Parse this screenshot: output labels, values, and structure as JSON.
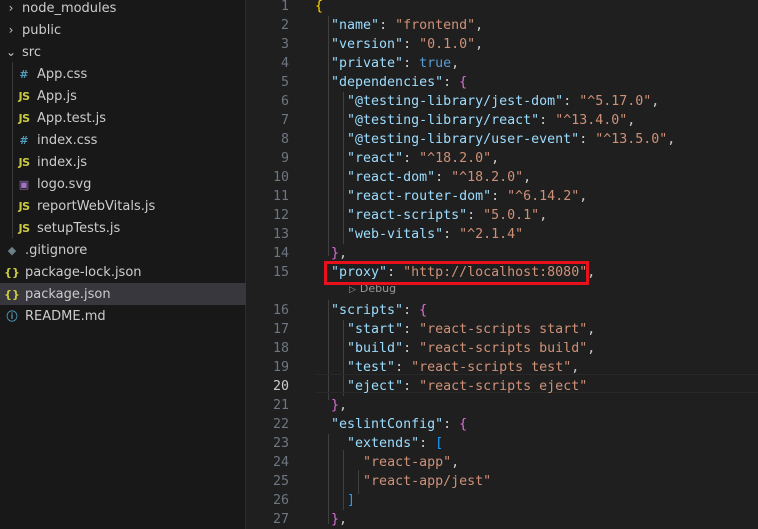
{
  "explorer": {
    "items": [
      {
        "label": "node_modules",
        "type": "folder-collapsed"
      },
      {
        "label": "public",
        "type": "folder-collapsed"
      },
      {
        "label": "src",
        "type": "folder-expanded"
      },
      {
        "label": "App.css",
        "type": "css"
      },
      {
        "label": "App.js",
        "type": "js"
      },
      {
        "label": "App.test.js",
        "type": "js"
      },
      {
        "label": "index.css",
        "type": "css"
      },
      {
        "label": "index.js",
        "type": "js"
      },
      {
        "label": "logo.svg",
        "type": "svg"
      },
      {
        "label": "reportWebVitals.js",
        "type": "js"
      },
      {
        "label": "setupTests.js",
        "type": "js"
      },
      {
        "label": ".gitignore",
        "type": "git"
      },
      {
        "label": "package-lock.json",
        "type": "json"
      },
      {
        "label": "package.json",
        "type": "json",
        "selected": true
      },
      {
        "label": "README.md",
        "type": "info"
      }
    ],
    "icons": {
      "css": "#",
      "js": "JS",
      "svg": "▣",
      "git": "◆",
      "json": "{}",
      "info": "ⓘ",
      "chevron_right": "›",
      "chevron_down": "⌄"
    }
  },
  "editor": {
    "active_line": "20",
    "codelens_label": "Debug",
    "lines": [
      {
        "n": "1",
        "t": "{"
      },
      {
        "n": "2",
        "t": "  \"name\": \"frontend\","
      },
      {
        "n": "3",
        "t": "  \"version\": \"0.1.0\","
      },
      {
        "n": "4",
        "t": "  \"private\": true,"
      },
      {
        "n": "5",
        "t": "  \"dependencies\": {"
      },
      {
        "n": "6",
        "t": "    \"@testing-library/jest-dom\": \"^5.17.0\","
      },
      {
        "n": "7",
        "t": "    \"@testing-library/react\": \"^13.4.0\","
      },
      {
        "n": "8",
        "t": "    \"@testing-library/user-event\": \"^13.5.0\","
      },
      {
        "n": "9",
        "t": "    \"react\": \"^18.2.0\","
      },
      {
        "n": "10",
        "t": "    \"react-dom\": \"^18.2.0\","
      },
      {
        "n": "11",
        "t": "    \"react-router-dom\": \"^6.14.2\","
      },
      {
        "n": "12",
        "t": "    \"react-scripts\": \"5.0.1\","
      },
      {
        "n": "13",
        "t": "    \"web-vitals\": \"^2.1.4\""
      },
      {
        "n": "14",
        "t": "  },"
      },
      {
        "n": "15",
        "t": "  \"proxy\": \"http://localhost:8080\","
      },
      {
        "n": "16",
        "t": "  \"scripts\": {"
      },
      {
        "n": "17",
        "t": "    \"start\": \"react-scripts start\","
      },
      {
        "n": "18",
        "t": "    \"build\": \"react-scripts build\","
      },
      {
        "n": "19",
        "t": "    \"test\": \"react-scripts test\","
      },
      {
        "n": "20",
        "t": "    \"eject\": \"react-scripts eject\""
      },
      {
        "n": "21",
        "t": "  },"
      },
      {
        "n": "22",
        "t": "  \"eslintConfig\": {"
      },
      {
        "n": "23",
        "t": "    \"extends\": ["
      },
      {
        "n": "24",
        "t": "      \"react-app\","
      },
      {
        "n": "25",
        "t": "      \"react-app/jest\""
      },
      {
        "n": "26",
        "t": "    ]"
      },
      {
        "n": "27",
        "t": "  },"
      }
    ]
  },
  "colors": {
    "highlight_border": "#e8101b",
    "key": "#9cdcfe",
    "string": "#ce9178",
    "boolean": "#569cd6"
  }
}
